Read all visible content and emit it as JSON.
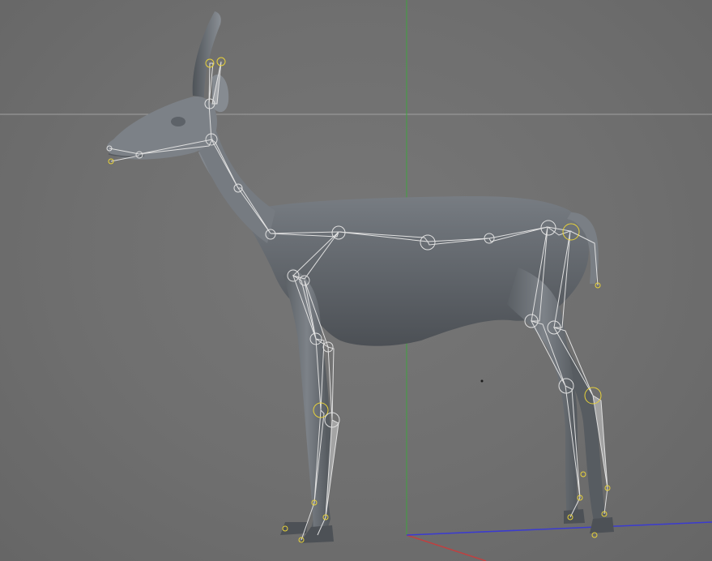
{
  "app": {
    "view": "perspective-viewport"
  },
  "scene": {
    "object": "gazelle-mesh",
    "rig": "skeleton-joints",
    "colors": {
      "background": "#6f6f6f",
      "mesh": "#6f747a",
      "horizon_line": "#a0a0a0",
      "y_axis": "#3fa23f",
      "x_axis": "#c04040",
      "z_axis": "#3b3bd0",
      "joint_outline": "#e0e0e0",
      "joint_highlight": "#e8d23a"
    }
  }
}
